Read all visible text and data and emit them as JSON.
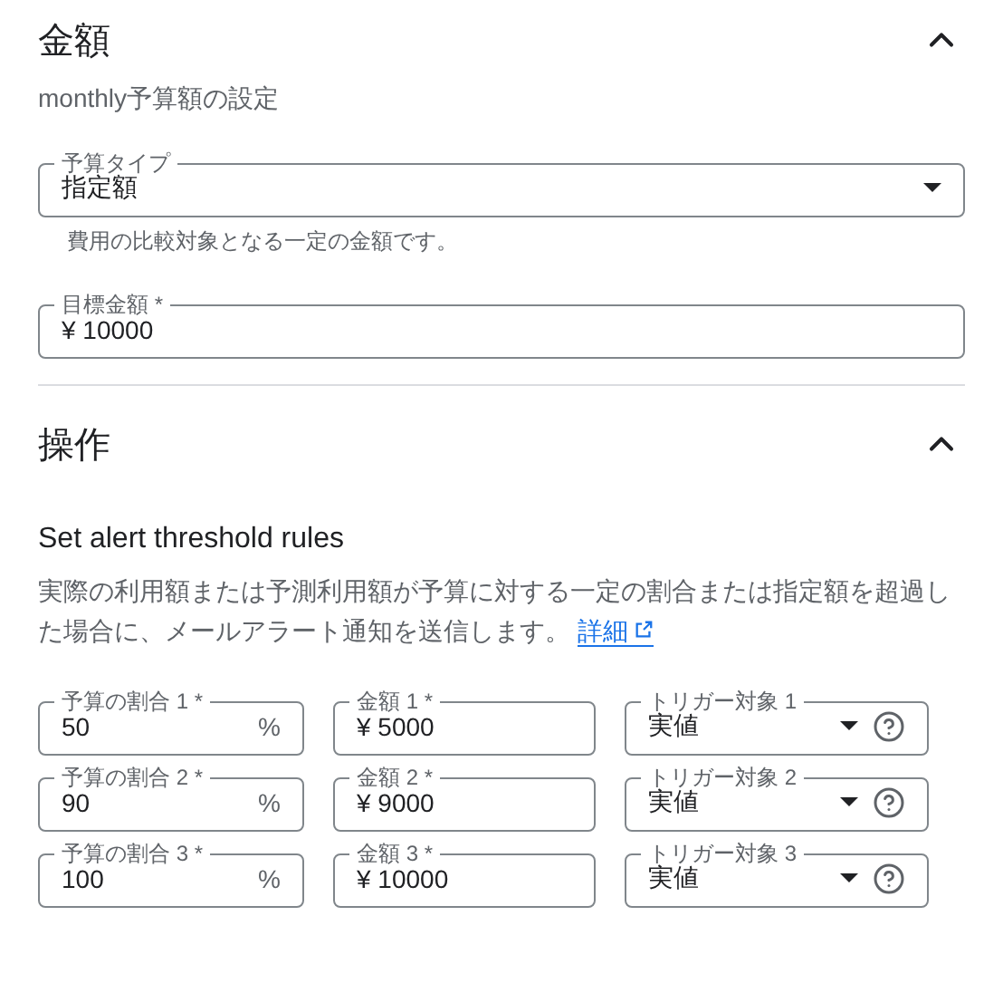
{
  "sections": [
    {
      "title": "金額",
      "expanded": true
    },
    {
      "title": "操作",
      "expanded": true
    }
  ],
  "amount": {
    "subtitle": "monthly予算額の設定",
    "budget_type": {
      "label": "予算タイプ",
      "value": "指定額",
      "helper": "費用の比較対象となる一定の金額です。"
    },
    "target": {
      "label": "目標金額 *",
      "value": "¥ 10000"
    }
  },
  "actions": {
    "heading": "Set alert threshold rules",
    "description": "実際の利用額または予測利用額が予算に対する一定の割合または指定額を超過した場合に、メールアラート通知を送信します。",
    "link": "詳細",
    "rules": [
      {
        "percent_label": "予算の割合 1 *",
        "percent": "50",
        "unit": "%",
        "amount_label": "金額 1 *",
        "amount": "¥ 5000",
        "trigger_label": "トリガー対象 1",
        "trigger": "実値"
      },
      {
        "percent_label": "予算の割合 2 *",
        "percent": "90",
        "unit": "%",
        "amount_label": "金額 2 *",
        "amount": "¥ 9000",
        "trigger_label": "トリガー対象 2",
        "trigger": "実値"
      },
      {
        "percent_label": "予算の割合 3 *",
        "percent": "100",
        "unit": "%",
        "amount_label": "金額 3 *",
        "amount": "¥ 10000",
        "trigger_label": "トリガー対象 3",
        "trigger": "実値"
      }
    ]
  }
}
